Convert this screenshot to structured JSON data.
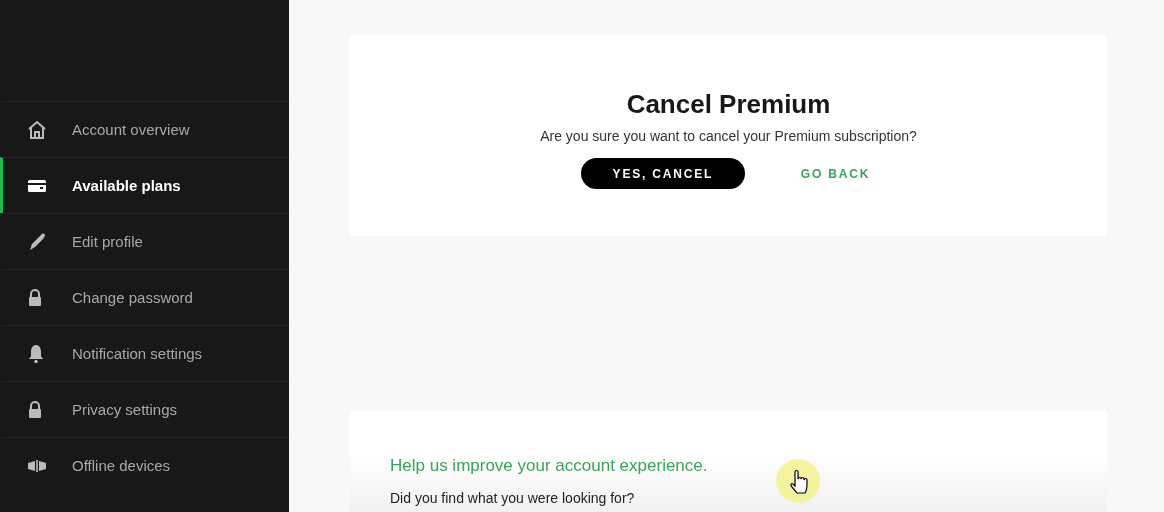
{
  "sidebar": {
    "items": [
      {
        "label": "Account overview",
        "kind": "home",
        "selected": false
      },
      {
        "label": "Available plans",
        "kind": "card",
        "selected": true
      },
      {
        "label": "Edit profile",
        "kind": "pen",
        "selected": false
      },
      {
        "label": "Change password",
        "kind": "lock",
        "selected": false
      },
      {
        "label": "Notification settings",
        "kind": "bell",
        "selected": false
      },
      {
        "label": "Privacy settings",
        "kind": "lock",
        "selected": false
      },
      {
        "label": "Offline devices",
        "kind": "devices",
        "selected": false
      }
    ]
  },
  "dialog": {
    "title": "Cancel Premium",
    "message": "Are you sure you want to cancel your Premium subscription?",
    "buttons": [
      {
        "label": "YES, CANCEL",
        "kind": "primary"
      },
      {
        "label": "GO BACK",
        "kind": "link"
      }
    ]
  },
  "feedback": {
    "heading": "Help us improve your account experience.",
    "question": "Did you find what you were looking for?"
  }
}
